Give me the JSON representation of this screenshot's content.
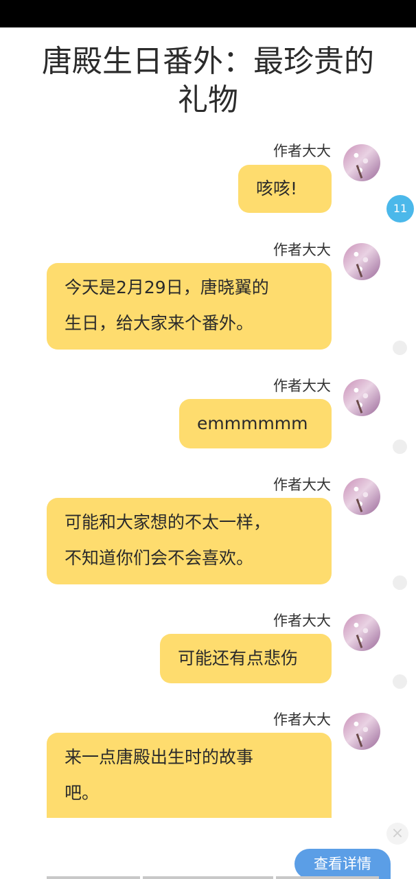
{
  "title": "唐殿生日番外：最珍贵的礼物",
  "author_name": "作者大大",
  "unread_count": "11",
  "messages": [
    {
      "author": "作者大大",
      "text": "咳咳!"
    },
    {
      "author": "作者大大",
      "text": "今天是2月29日，唐晓翼的\n生日，给大家来个番外。"
    },
    {
      "author": "作者大大",
      "text": "emmmmmm"
    },
    {
      "author": "作者大大",
      "text": "可能和大家想的不太一样，\n不知道你们会不会喜欢。"
    },
    {
      "author": "作者大大",
      "text": "可能还有点悲伤"
    },
    {
      "author": "作者大大",
      "text": "来一点唐殿出生时的故事\n吧。"
    }
  ],
  "close_label": "×",
  "detail_button_label": "查看详情",
  "colors": {
    "bubble": "#fedc6e",
    "unread_badge": "#4bb8ea",
    "detail_button": "#5b9ee6"
  }
}
